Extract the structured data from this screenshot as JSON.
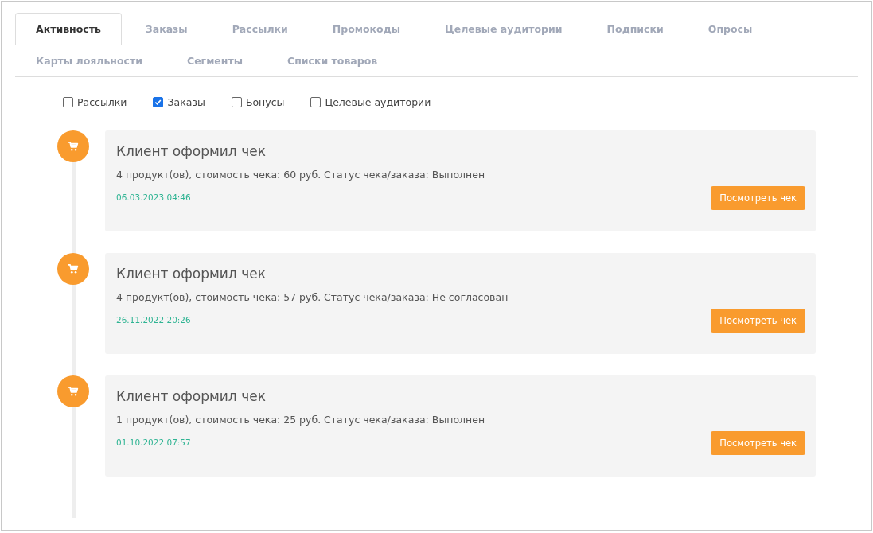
{
  "tabs": [
    {
      "label": "Активность",
      "selected": true
    },
    {
      "label": "Заказы",
      "selected": false
    },
    {
      "label": "Рассылки",
      "selected": false
    },
    {
      "label": "Промокоды",
      "selected": false
    },
    {
      "label": "Целевые аудитории",
      "selected": false
    },
    {
      "label": "Подписки",
      "selected": false
    },
    {
      "label": "Опросы",
      "selected": false
    },
    {
      "label": "Карты лояльности",
      "selected": false
    },
    {
      "label": "Сегменты",
      "selected": false
    },
    {
      "label": "Списки товаров",
      "selected": false
    }
  ],
  "filters": [
    {
      "label": "Рассылки",
      "checked": false
    },
    {
      "label": "Заказы",
      "checked": true
    },
    {
      "label": "Бонусы",
      "checked": false
    },
    {
      "label": "Целевые аудитории",
      "checked": false
    }
  ],
  "events": [
    {
      "title": "Клиент оформил чек",
      "description": "4 продукт(ов), стоимость чека: 60 руб. Статус чека/заказа: Выполнен",
      "date": "06.03.2023 04:46",
      "button": "Посмотреть чек"
    },
    {
      "title": "Клиент оформил чек",
      "description": "4 продукт(ов), стоимость чека: 57 руб. Статус чека/заказа: Не согласован",
      "date": "26.11.2022 20:26",
      "button": "Посмотреть чек"
    },
    {
      "title": "Клиент оформил чек",
      "description": "1 продукт(ов), стоимость чека: 25 руб. Статус чека/заказа: Выполнен",
      "date": "01.10.2022 07:57",
      "button": "Посмотреть чек"
    }
  ]
}
